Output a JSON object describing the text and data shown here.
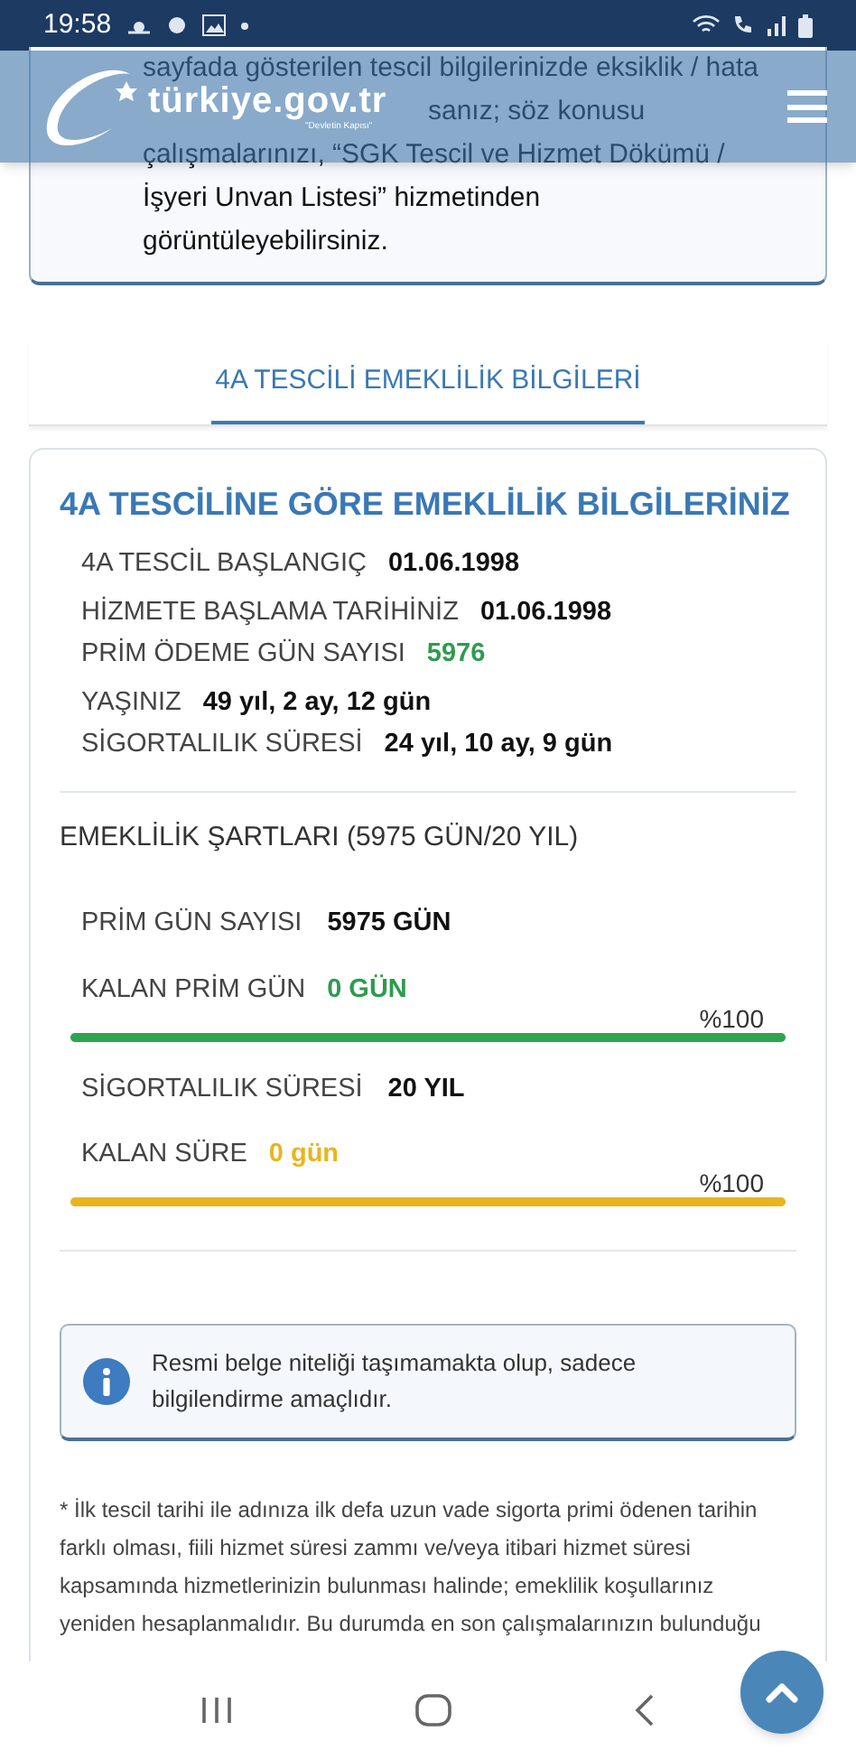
{
  "status_bar": {
    "time": "19:58"
  },
  "header": {
    "logo_text": "türkiye.gov.tr",
    "logo_tagline": "\"Devletin Kapısı\""
  },
  "notice": {
    "lines": [
      "sayfada gösterilen tescil bilgilerinizde eksiklik / hata",
      "sanız; söz konusu",
      "çalışmalarınızı, “SGK Tescil ve Hizmet Dökümü /",
      "İşyeri Unvan Listesi” hizmetinden",
      "görüntüleyebilirsiniz."
    ]
  },
  "tabs": [
    {
      "label": "4A TESCİLİ EMEKLİLİK BİLGİLERİ",
      "selected": true
    }
  ],
  "card": {
    "title": "4A TESCİLİNE GÖRE EMEKLİLİK BİLGİLERİNİZ",
    "groups": [
      [
        {
          "label": "4A TESCİL BAŞLANGIÇ",
          "value": "01.06.1998",
          "kind": "plain"
        }
      ],
      [
        {
          "label": "HİZMETE BAŞLAMA TARİHİNİZ",
          "value": "01.06.1998",
          "kind": "plain"
        },
        {
          "label": "PRİM ÖDEME GÜN SAYISI",
          "value": "5976",
          "kind": "good"
        }
      ],
      [
        {
          "label": "YAŞINIZ",
          "value": "49 yıl, 2 ay, 12 gün",
          "kind": "plain"
        },
        {
          "label": "SİGORTALILIK SÜRESİ",
          "value": "24 yıl, 10 ay, 9 gün",
          "kind": "plain"
        }
      ]
    ],
    "conditions": {
      "title": "EMEKLİLİK ŞARTLARI (5975 GÜN/20 YIL)",
      "items": [
        {
          "label": "PRİM GÜN SAYISI",
          "value": "5975 GÜN",
          "remaining_label": "KALAN PRİM GÜN",
          "remaining_value": "0 GÜN",
          "kind": "good",
          "percent": "%100",
          "level": 1
        },
        {
          "label": "SİGORTALILIK SÜRESİ",
          "value": "20 YIL",
          "remaining_label": "KALAN SÜRE",
          "remaining_value": "0 gün",
          "kind": "warn",
          "percent": "%100",
          "level": 1
        }
      ]
    },
    "info": "Resmi belge niteliği taşımamakta olup, sadece bilgilendirme amaçlıdır."
  },
  "footnote": "* İlk tescil tarihi ile adınıza ilk defa uzun vade sigorta primi ödenen tarihin farklı olması, fiili hizmet süresi zammı ve/veya itibari hizmet süresi kapsamında hizmetlerinizin bulunması halinde; emeklilik koşullarınız yeniden hesaplanmalıdır. Bu durumda en son çalışmalarınızın bulunduğu"
}
